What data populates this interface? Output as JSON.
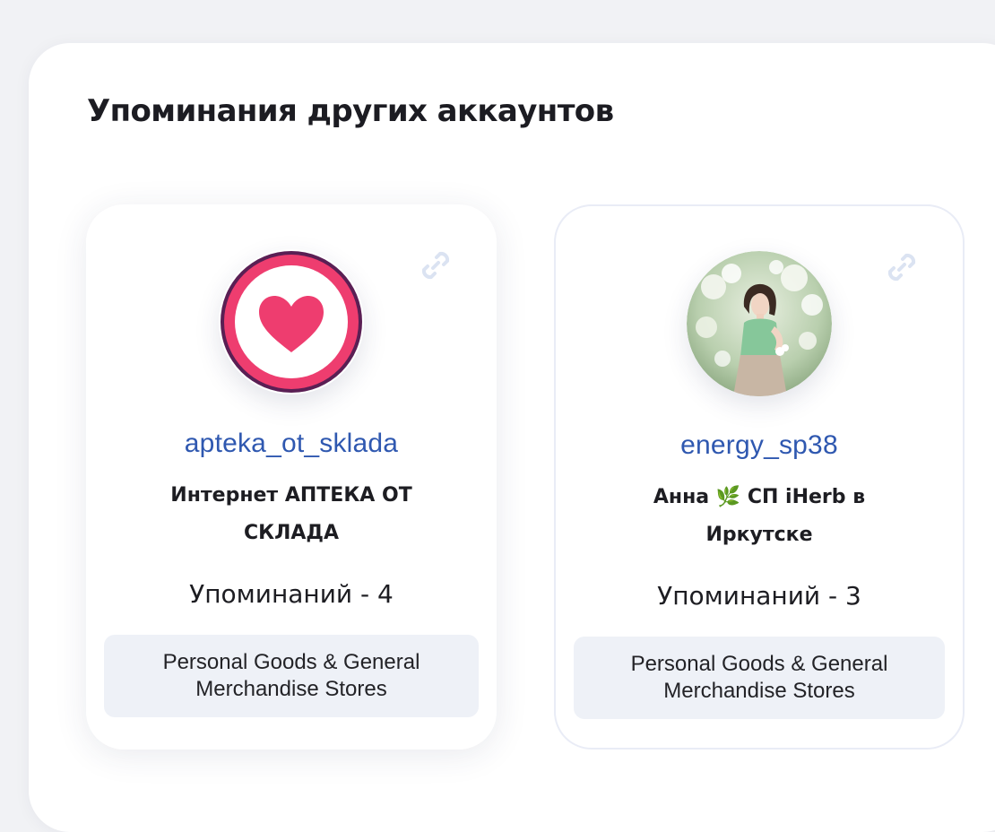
{
  "section": {
    "title": "Упоминания других аккаунтов"
  },
  "accounts": [
    {
      "username": "apteka_ot_sklada",
      "full_name": "Интернет АПТЕКА ОТ СКЛАДА",
      "mentions_label": "Упоминаний - 4",
      "category": "Personal Goods & General Merchandise Stores",
      "avatar_icon": "heart-logo-icon"
    },
    {
      "username": "energy_sp38",
      "full_name": "Анна 🌿  СП iHerb в Иркутске",
      "mentions_label": "Упоминаний - 3",
      "category": "Personal Goods & General Merchandise Stores",
      "avatar_icon": "profile-photo"
    }
  ],
  "icons": {
    "link": "link-icon"
  },
  "colors": {
    "username": "#2f58b0",
    "heart": "#ee3d6f",
    "heart_ring": "#5a1f54",
    "category_bg": "#eef1f7",
    "link_icon": "#dbe3f2"
  }
}
